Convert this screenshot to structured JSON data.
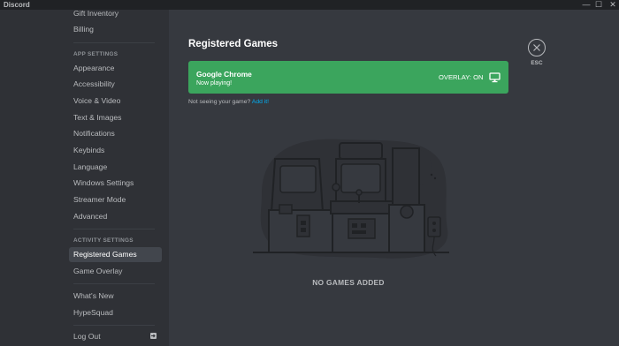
{
  "window": {
    "title": "Discord",
    "controls": {
      "minimize": "—",
      "maximize": "☐",
      "close": "✕"
    }
  },
  "sidebar": {
    "items_top": [
      {
        "label": "Gift Inventory"
      },
      {
        "label": "Billing"
      }
    ],
    "app_settings_header": "APP SETTINGS",
    "app_settings_items": [
      {
        "label": "Appearance"
      },
      {
        "label": "Accessibility"
      },
      {
        "label": "Voice & Video"
      },
      {
        "label": "Text & Images"
      },
      {
        "label": "Notifications"
      },
      {
        "label": "Keybinds"
      },
      {
        "label": "Language"
      },
      {
        "label": "Windows Settings"
      },
      {
        "label": "Streamer Mode"
      },
      {
        "label": "Advanced"
      }
    ],
    "activity_settings_header": "ACTIVITY SETTINGS",
    "activity_items": [
      {
        "label": "Registered Games",
        "selected": true
      },
      {
        "label": "Game Overlay"
      }
    ],
    "misc_items": [
      {
        "label": "What's New"
      },
      {
        "label": "HypeSquad"
      }
    ],
    "logout": {
      "label": "Log Out",
      "icon": "logout-icon"
    }
  },
  "main": {
    "title": "Registered Games",
    "current_game": {
      "name": "Google Chrome",
      "status": "Now playing!",
      "overlay_label": "OVERLAY: ON",
      "overlay_icon": "monitor-icon",
      "color": "#3ba55d"
    },
    "hint_text": "Not seeing your game?",
    "hint_link": "Add it!",
    "empty_state": "NO GAMES ADDED"
  },
  "close": {
    "label": "ESC",
    "icon": "close-icon"
  },
  "colors": {
    "sidebar": "#2f3136",
    "content": "#36393f",
    "selected": "#42464d",
    "link": "#00aff4",
    "accent_green": "#3ba55d"
  }
}
